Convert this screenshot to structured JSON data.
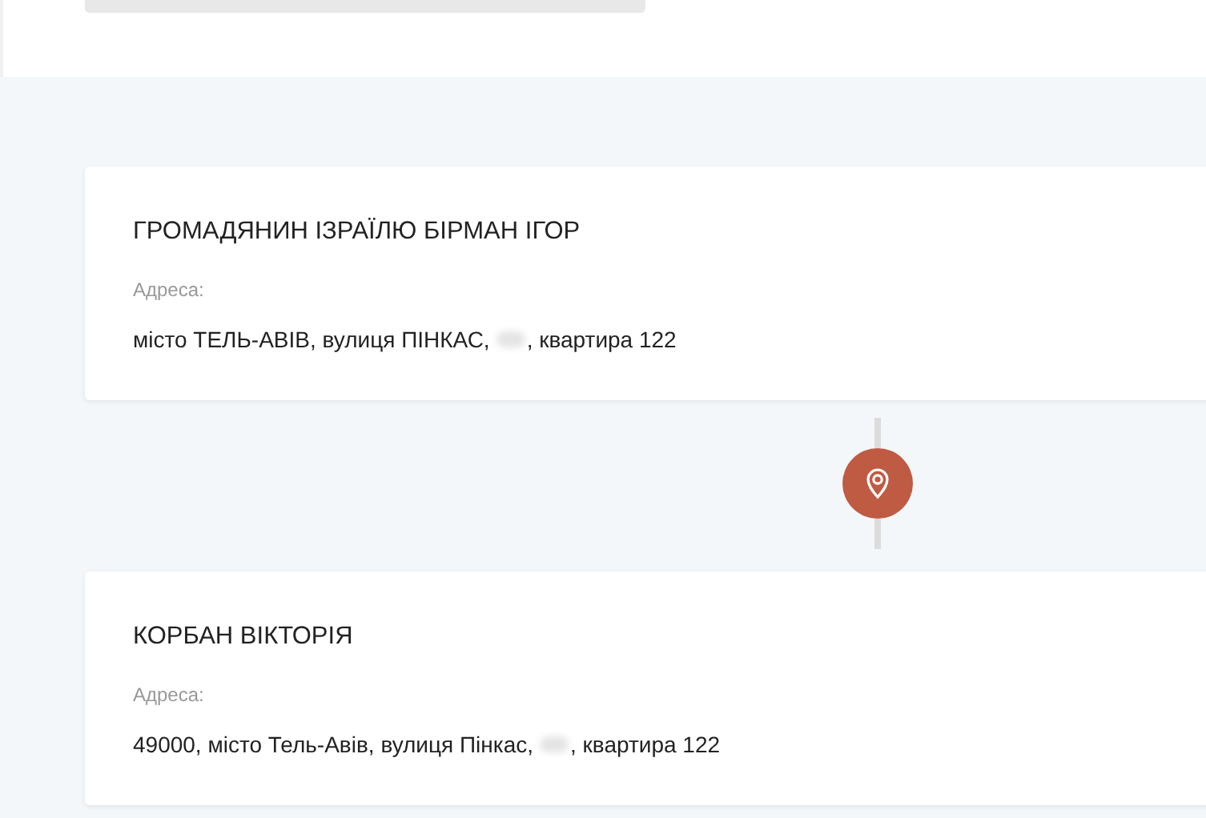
{
  "parties": [
    {
      "name": "ГРОМАДЯНИН ІЗРАЇЛЮ БІРМАН ІГОР",
      "address_label": "Адреса:",
      "address_start": "місто ТЕЛЬ-АВІВ, вулиця ПІНКАС,",
      "redacted": true,
      "address_end": ", квартира 122"
    },
    {
      "name": "КОРБАН ВІКТОРІЯ",
      "address_label": "Адреса:",
      "address_start": "49000, місто Тель-Авів, вулиця Пінкас,",
      "redacted": true,
      "address_end": ", квартира 122"
    }
  ]
}
